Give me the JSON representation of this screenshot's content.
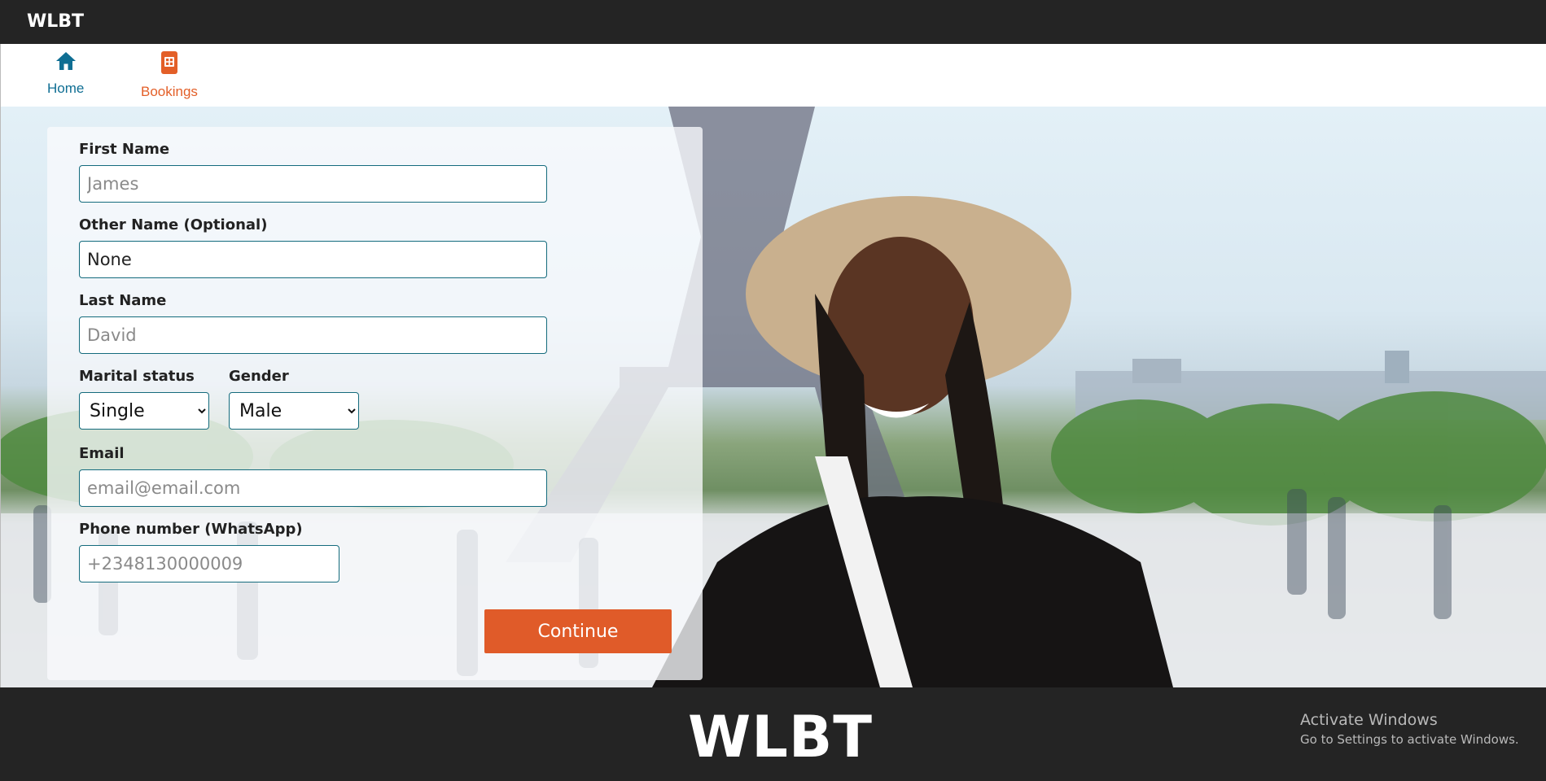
{
  "app": {
    "brand": "WLBT"
  },
  "nav": {
    "items": [
      {
        "label": "Home",
        "icon": "home-icon"
      },
      {
        "label": "Bookings",
        "icon": "bookings-icon"
      }
    ]
  },
  "form": {
    "first_name": {
      "label": "First Name",
      "placeholder": "James",
      "value": ""
    },
    "other_name": {
      "label": "Other Name (Optional)",
      "placeholder": "",
      "value": "None"
    },
    "last_name": {
      "label": "Last Name",
      "placeholder": "David",
      "value": ""
    },
    "marital_status": {
      "label": "Marital status",
      "selected": "Single"
    },
    "gender": {
      "label": "Gender",
      "selected": "Male"
    },
    "email": {
      "label": "Email",
      "placeholder": "email@email.com",
      "value": ""
    },
    "phone": {
      "label": "Phone number (WhatsApp)",
      "placeholder": "+2348130000009",
      "value": ""
    },
    "continue_label": "Continue"
  },
  "footer": {
    "brand": "WLBT"
  },
  "watermark": {
    "title": "Activate Windows",
    "subtitle": "Go to Settings to activate Windows."
  },
  "colors": {
    "header_bg": "#242424",
    "accent_blue": "#0f6e93",
    "accent_orange": "#e35f28",
    "button_bg": "#e05b29",
    "input_border": "#146b7d"
  }
}
